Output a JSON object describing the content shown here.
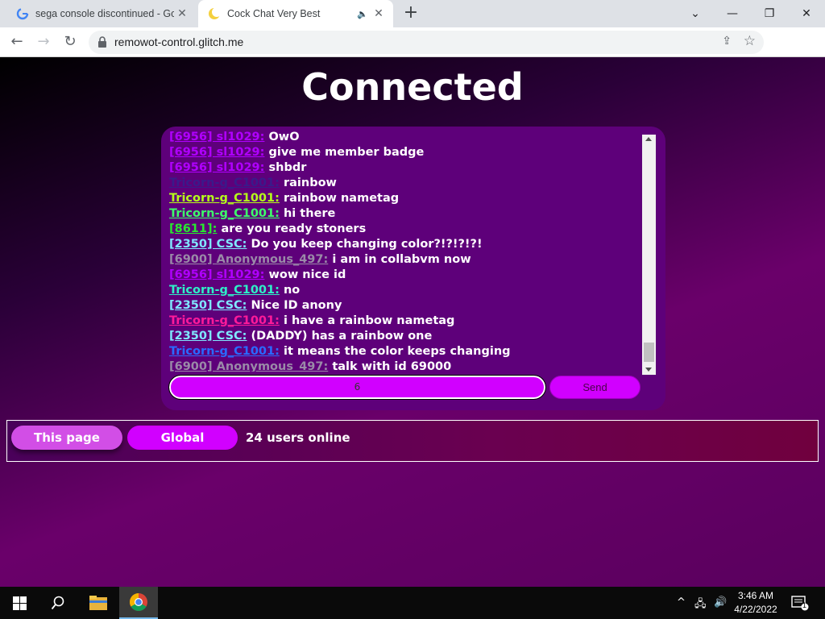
{
  "browser": {
    "tabs": [
      {
        "title": "sega console discontinued - Goo",
        "favicon": "google-g-icon"
      },
      {
        "title": "Cock Chat Very Best",
        "favicon": "crescent-moon-icon"
      }
    ],
    "url": "remowot-control.glitch.me"
  },
  "page": {
    "heading": "Connected",
    "messages": [
      {
        "user": "[6956] sl1029:",
        "text": "OwO",
        "color": "#b000ff"
      },
      {
        "user": "[6956] sl1029:",
        "text": "give me member badge",
        "color": "#b000ff"
      },
      {
        "user": "[6956] sl1029:",
        "text": "shbdr",
        "color": "#b000ff"
      },
      {
        "user": "Tricorn-g_C1001:",
        "text": "rainbow",
        "color": "#3a1a8a"
      },
      {
        "user": "Tricorn-g_C1001:",
        "text": "rainbow nametag",
        "color": "#b6ff1a"
      },
      {
        "user": "Tricorn-g_C1001:",
        "text": "hi there",
        "color": "#3cff6a"
      },
      {
        "user": "[8611]:",
        "text": "are you ready stoners",
        "color": "#28e830"
      },
      {
        "user": "[2350] CSC:",
        "text": "Do you keep changing color?!?!?!?!",
        "color": "#7fe8ff"
      },
      {
        "user": "[6900] Anonymous_497:",
        "text": "i am in collabvm now",
        "color": "#9a8aa8"
      },
      {
        "user": "[6956] sl1029:",
        "text": "wow nice id",
        "color": "#b000ff"
      },
      {
        "user": "Tricorn-g_C1001:",
        "text": "no",
        "color": "#2ef0c8"
      },
      {
        "user": "[2350] CSC:",
        "text": "Nice ID anony",
        "color": "#7fe8ff"
      },
      {
        "user": "Tricorn-g_C1001:",
        "text": "i have a rainbow nametag",
        "color": "#ff1a9a"
      },
      {
        "user": "[2350] CSC:",
        "text": "(DADDY) has a rainbow one",
        "color": "#7fe8ff"
      },
      {
        "user": "Tricorn-g_C1001:",
        "text": "it means the color keeps changing",
        "color": "#2a6aff"
      },
      {
        "user": "[6900] Anonymous_497:",
        "text": "talk with id 69000",
        "color": "#9a8aa8"
      }
    ],
    "input_value": "6",
    "send_label": "Send",
    "this_page_label": "This page",
    "global_label": "Global",
    "online_text": "24 users online"
  },
  "taskbar": {
    "time": "3:46 AM",
    "date": "4/22/2022",
    "notification_count": "1"
  }
}
